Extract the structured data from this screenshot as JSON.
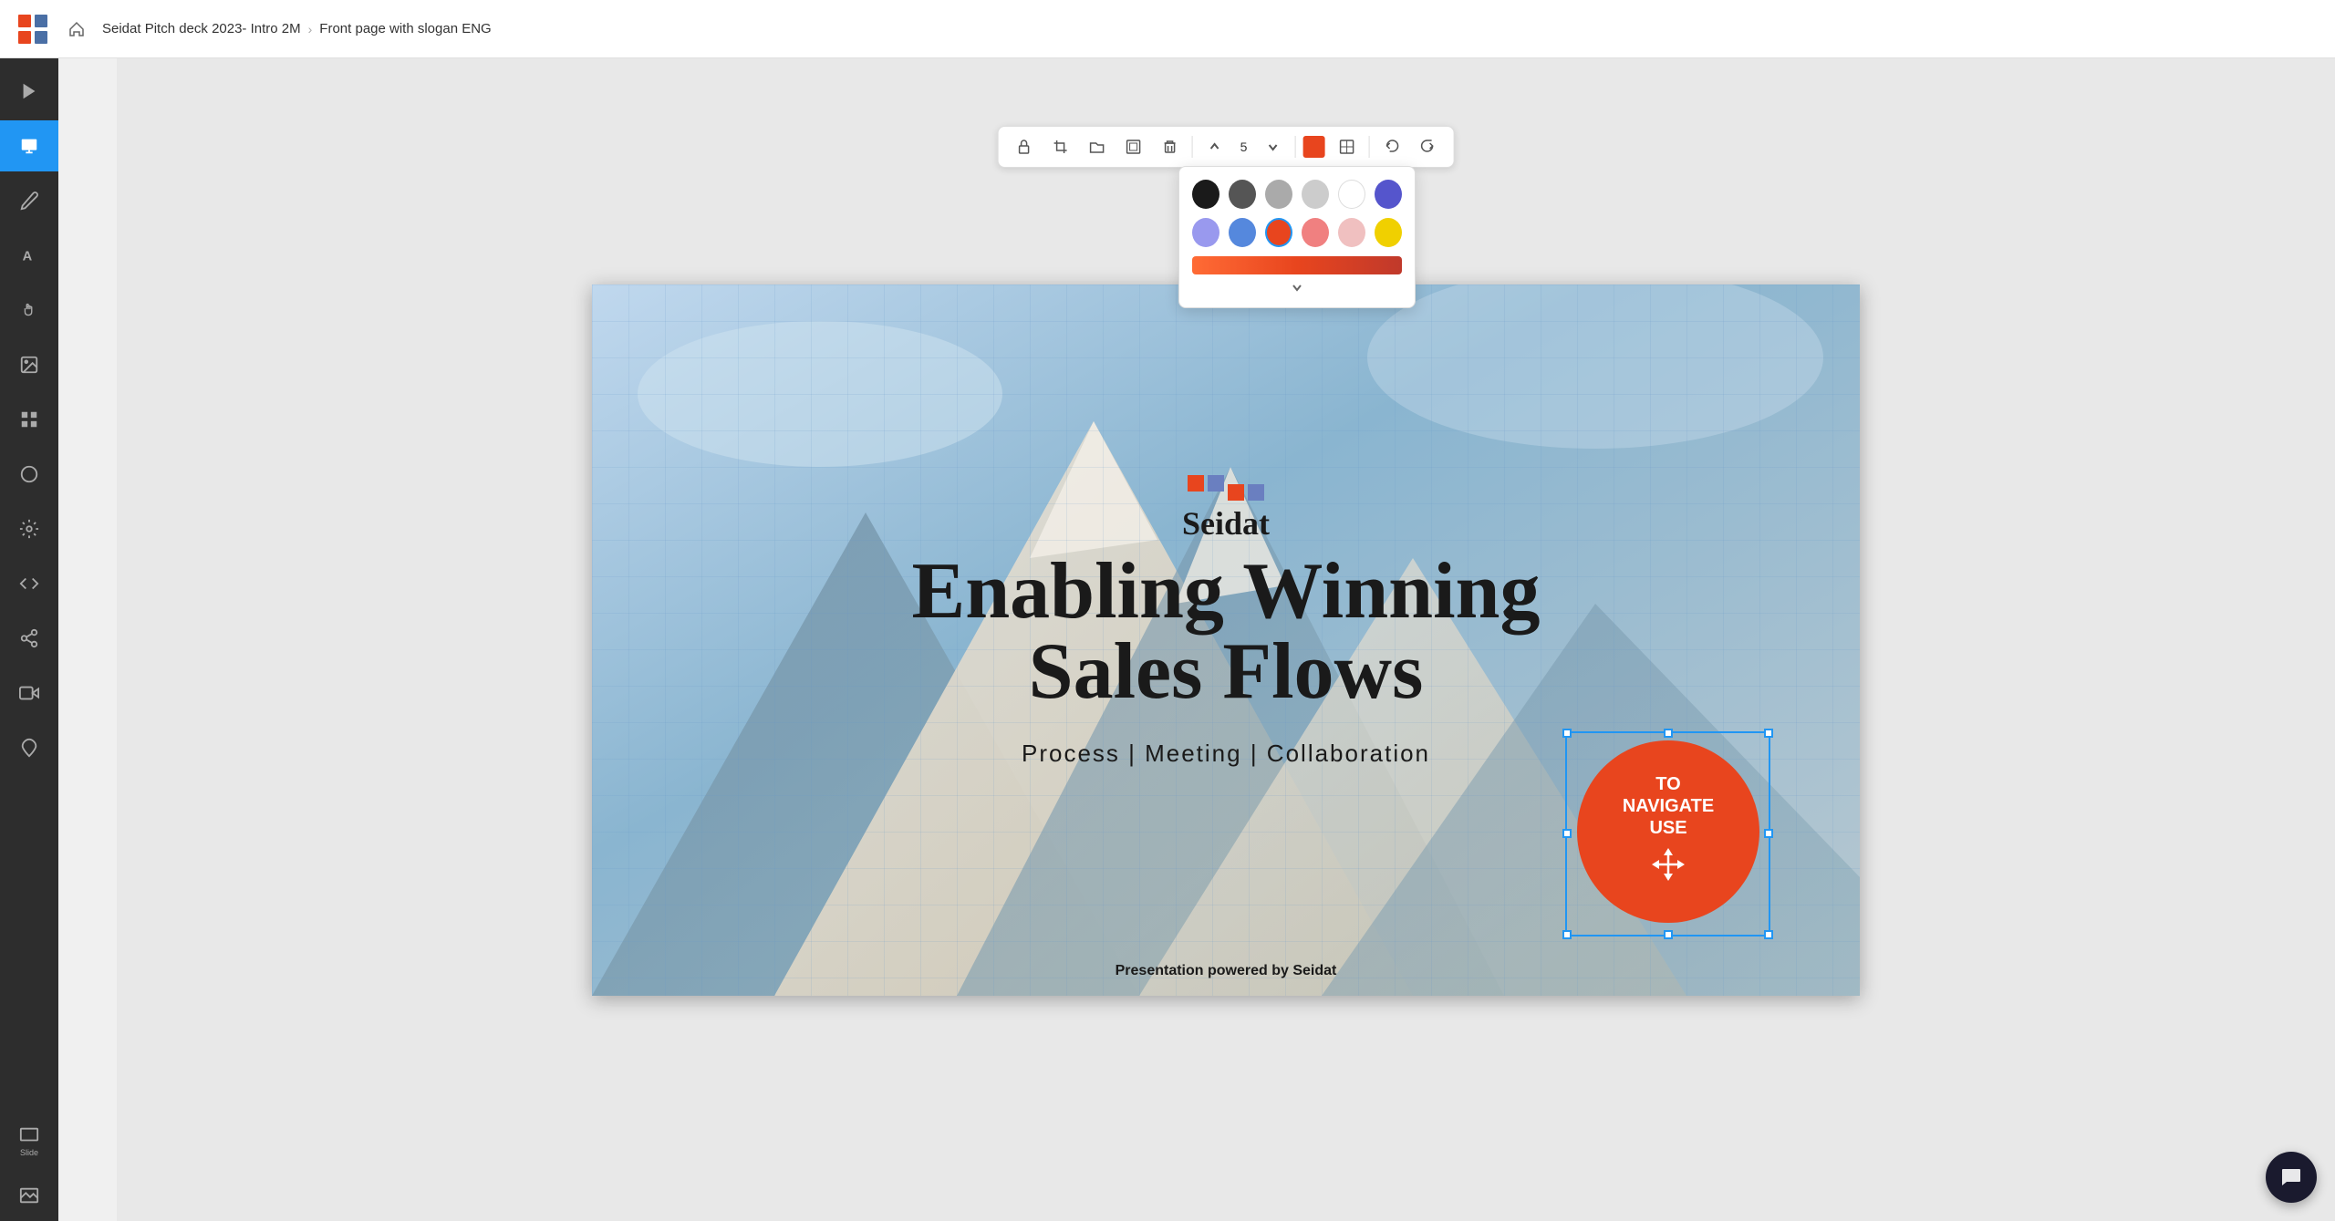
{
  "topbar": {
    "breadcrumb_parent": "Seidat Pitch deck 2023- Intro 2M",
    "breadcrumb_current": "Front page with slogan ENG"
  },
  "sidebar_left": {
    "items": [
      {
        "id": "play",
        "label": "",
        "icon": "play"
      },
      {
        "id": "slides",
        "label": "",
        "icon": "slides",
        "active": true
      },
      {
        "id": "pen",
        "label": "",
        "icon": "pen"
      },
      {
        "id": "text",
        "label": "",
        "icon": "text"
      },
      {
        "id": "hand",
        "label": "",
        "icon": "hand"
      },
      {
        "id": "image",
        "label": "",
        "icon": "image"
      },
      {
        "id": "grid",
        "label": "",
        "icon": "grid"
      },
      {
        "id": "shape",
        "label": "",
        "icon": "shape"
      },
      {
        "id": "settings",
        "label": "",
        "icon": "settings"
      },
      {
        "id": "code",
        "label": "",
        "icon": "code"
      },
      {
        "id": "share",
        "label": "",
        "icon": "share"
      },
      {
        "id": "media",
        "label": "",
        "icon": "media"
      },
      {
        "id": "dropper",
        "label": "",
        "icon": "dropper"
      },
      {
        "id": "slide-thumb",
        "label": "Slide",
        "icon": "slide-thumb"
      },
      {
        "id": "slide-img",
        "label": "",
        "icon": "slide-img"
      }
    ]
  },
  "toolbar": {
    "buttons": [
      "lock",
      "crop",
      "folder",
      "frame",
      "delete",
      "up",
      "count",
      "down",
      "color",
      "pattern",
      "undo",
      "redo"
    ],
    "count_value": "5",
    "selected_color": "#e8451e"
  },
  "color_picker": {
    "colors_row1": [
      "#1a1a1a",
      "#555555",
      "#aaaaaa",
      "#cccccc",
      "#ffffff",
      "#5555cc"
    ],
    "colors_row2": [
      "#9999ee",
      "#5588dd",
      "#e8451e",
      "#f08080",
      "#f0c0c0",
      "#f0d000"
    ],
    "selected_color": "#e8451e"
  },
  "slide": {
    "brand_name": "Seidat",
    "headline_line1": "Enabling Winning",
    "headline_line2": "Sales Flows",
    "subtitle": "Process  |  Meeting  |  Collaboration",
    "footer": "Presentation powered by Seidat",
    "navigate_text": "TO NAVIGATE USE",
    "navigate_symbol": "⤢"
  }
}
